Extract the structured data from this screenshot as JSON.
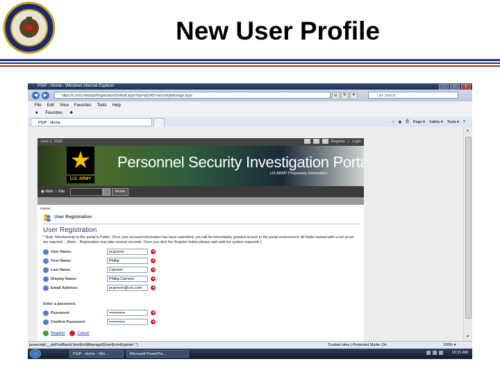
{
  "slide": {
    "title": "New User Profile"
  },
  "browser": {
    "window_title": "PSIP - Home - Windows Internet Explorer",
    "address": "https://s.army.mil/psip/Registration/Default.aspx?mp=a&SRC=security&Manage.aspx",
    "search_placeholder": "Live Search",
    "menu": [
      "File",
      "Edit",
      "View",
      "Favorites",
      "Tools",
      "Help"
    ],
    "favorites_label": "Favorites",
    "tab_label": "PSIP - Home",
    "commands": [
      "Page ▾",
      "Safety ▾",
      "Tools ▾"
    ]
  },
  "site": {
    "date": "June 2, 2009",
    "register_link": "Register",
    "login_link": "Login",
    "banner_title": "Personnel Security Investigation Portal",
    "banner_subtitle": "US ARMY Proprietary Information",
    "banner_logo_text": "U.S. ARMY",
    "search_web": "Web",
    "search_site": "Site",
    "home_button": "Home"
  },
  "content": {
    "breadcrumb": "Home",
    "section_heading": "User Registration",
    "title": "User Registration",
    "note": "* Note: Membership to this portal is Public. Once your account information has been submitted, you will be immediately granted access to the portal environment. All fields marked with a red arrow are required. - (Note: - Registration may take several seconds. Once you click the Register button please wait until the system responds.)",
    "fields": [
      {
        "label": "User Name:",
        "value": "pcarreon"
      },
      {
        "label": "First Name:",
        "value": "Phillip"
      },
      {
        "label": "Last Name:",
        "value": "Carreon"
      },
      {
        "label": "Display Name:",
        "value": "Phillip.Carreon"
      },
      {
        "label": "Email Address:",
        "value": "pcarreon@csc.com"
      }
    ],
    "password_heading": "Enter a password.",
    "password_fields": [
      {
        "label": "Password:",
        "value": "••••••••••••"
      },
      {
        "label": "Confirm Password:",
        "value": "••••••••••••"
      }
    ],
    "register_button": "Register",
    "cancel_button": "Cancel"
  },
  "status": {
    "left": "javascript:__doPostBack('dnn$ctr$Manage$User$cmdUpdate','')",
    "zone": "Trusted sites | Protected Mode: On",
    "zoom": "100% ▾"
  },
  "taskbar": {
    "tasks": [
      "PSIP - Home - Win...",
      "Microsoft PowerPoi..."
    ],
    "clock": "10:21 AM"
  },
  "colors": {
    "title_rule_blue": "#1f2f8a",
    "title_rule_red": "#c02020",
    "required_red": "#cc2020",
    "link_blue": "#1a3fb0"
  }
}
